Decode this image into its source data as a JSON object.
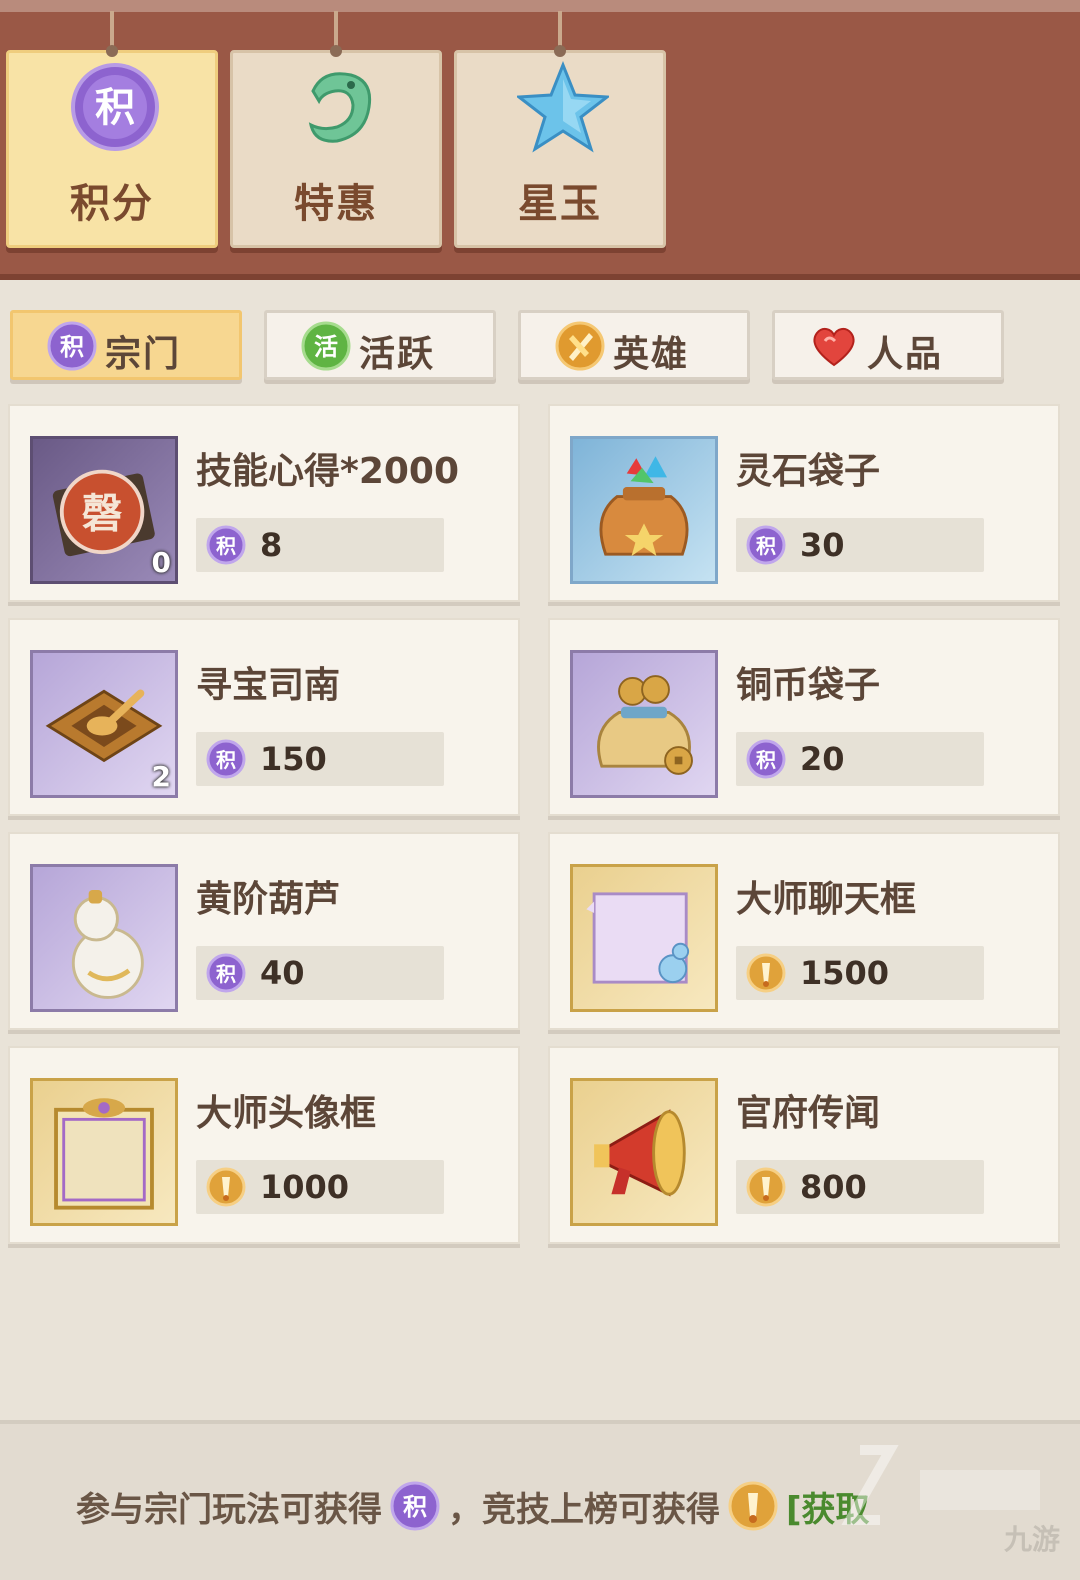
{
  "main_tabs": [
    {
      "label": "积分",
      "icon": "points-orb-icon",
      "icon_glyph": "积",
      "active": true
    },
    {
      "label": "特惠",
      "icon": "jade-dragon-icon",
      "active": false
    },
    {
      "label": "星玉",
      "icon": "blue-star-gem-icon",
      "active": false
    }
  ],
  "sub_tabs": [
    {
      "label": "宗门",
      "icon": "points-coin-icon",
      "icon_glyph": "积",
      "active": true
    },
    {
      "label": "活跃",
      "icon": "activity-coin-icon",
      "icon_glyph": "活",
      "active": false
    },
    {
      "label": "英雄",
      "icon": "hero-token-icon",
      "active": false
    },
    {
      "label": "人品",
      "icon": "heart-icon",
      "active": false
    }
  ],
  "items": [
    {
      "name": "技能心得*2000",
      "price": "8",
      "currency": "points-coin-icon",
      "qty": "0",
      "icon": "skill-tome-icon"
    },
    {
      "name": "灵石袋子",
      "price": "30",
      "currency": "points-coin-icon",
      "qty": "",
      "icon": "spirit-stone-bag-icon"
    },
    {
      "name": "寻宝司南",
      "price": "150",
      "currency": "points-coin-icon",
      "qty": "2",
      "icon": "treasure-compass-icon"
    },
    {
      "name": "铜币袋子",
      "price": "20",
      "currency": "points-coin-icon",
      "qty": "",
      "icon": "copper-coin-bag-icon"
    },
    {
      "name": "黄阶葫芦",
      "price": "40",
      "currency": "points-coin-icon",
      "qty": "",
      "icon": "gourd-icon"
    },
    {
      "name": "大师聊天框",
      "price": "1500",
      "currency": "arena-token-icon",
      "qty": "",
      "icon": "chat-frame-icon"
    },
    {
      "name": "大师头像框",
      "price": "1000",
      "currency": "arena-token-icon",
      "qty": "",
      "icon": "avatar-frame-icon"
    },
    {
      "name": "官府传闻",
      "price": "800",
      "currency": "arena-token-icon",
      "qty": "",
      "icon": "megaphone-icon"
    }
  ],
  "currency_glyph": "积",
  "footer": {
    "part1": "参与宗门玩法可获得",
    "part2": "，竞技上榜可获得",
    "part3": "[获取"
  },
  "watermark": "九游",
  "colors": {
    "banner": "#9a5846",
    "active_tab": "#f8e3a6",
    "active_subtab": "#f7d791",
    "points_purple": "#8a63c9",
    "token_gold": "#e0a23a"
  }
}
